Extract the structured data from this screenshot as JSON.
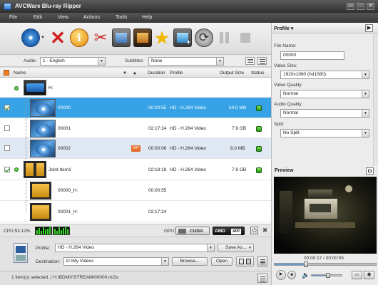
{
  "app": {
    "title": "AVCWare Blu-ray Ripper"
  },
  "window_controls": {
    "menu": "▭",
    "minimize": "–",
    "close": "✕"
  },
  "menu": [
    {
      "label": "File"
    },
    {
      "label": "Edit"
    },
    {
      "label": "View"
    },
    {
      "label": "Actions"
    },
    {
      "label": "Tools"
    },
    {
      "label": "Help"
    }
  ],
  "toolbar": {
    "buttons": [
      "open-disc-icon",
      "remove-icon",
      "info-icon",
      "clip-icon",
      "merge-icon",
      "effect-icon",
      "favorite-icon",
      "add-output-icon",
      "convert-icon",
      "pause-icon",
      "stop-icon"
    ]
  },
  "audio": {
    "label": "Audio:",
    "value": "1 - English"
  },
  "subtitles": {
    "label": "Subtitles:",
    "value": "None"
  },
  "columns": {
    "name": "Name",
    "duration": "Duration",
    "profile": "Profile",
    "output_size": "Output Size",
    "status": "Status"
  },
  "rows": [
    {
      "name": "H:",
      "duration": "",
      "profile": "",
      "size": "",
      "type": "disc"
    },
    {
      "name": "00000",
      "duration": "00:00:55",
      "profile": "HD - H.264 Video",
      "size": "54.0 MB",
      "checked": true,
      "selected": true
    },
    {
      "name": "00001",
      "duration": "02:17:24",
      "profile": "HD - H.264 Video",
      "size": "7.9 GB",
      "checked": false
    },
    {
      "name": "00002",
      "duration": "00:00:06",
      "profile": "HD - H.264 Video",
      "size": "6.0 MB",
      "checked": false,
      "badge": "SRT"
    },
    {
      "name": "Joint Item1",
      "duration": "02:18:19",
      "profile": "HD - H.264 Video",
      "size": "7.9 GB",
      "checked": true
    },
    {
      "name": "00000_H:",
      "duration": "00:00:55",
      "profile": "",
      "size": ""
    },
    {
      "name": "00001_H:",
      "duration": "02:17:24",
      "profile": "",
      "size": ""
    }
  ],
  "cpu": {
    "label": "CPU:53.12%"
  },
  "gpu": {
    "label": "GPU:",
    "cuda": "CUDA",
    "amd": "AMD",
    "app": "APP"
  },
  "output": {
    "profile_label": "Profile:",
    "profile_value": "HD - H.264 Video",
    "save_as": "Save As...",
    "destination_label": "Destination:",
    "destination_value": "D:\\My Videos",
    "browse": "Browse...",
    "open": "Open"
  },
  "statusbar": {
    "text": "1 item(s) selected. | H:\\BDMV\\STREAM\\00000.m2ts"
  },
  "profile_panel": {
    "title": "Profile ▾",
    "file_name_label": "File Name:",
    "file_name": "00000",
    "video_size_label": "Video Size:",
    "video_size": "1920x1080 (hd1080)",
    "video_quality_label": "Video Quality:",
    "video_quality": "Normal",
    "audio_quality_label": "Audio Quality:",
    "audio_quality": "Normal",
    "split_label": "Split:",
    "split": "No Split"
  },
  "preview": {
    "title": "Preview",
    "time": "00:00:17 / 00:00:55",
    "progress": 0.31,
    "volume": 0.55
  }
}
